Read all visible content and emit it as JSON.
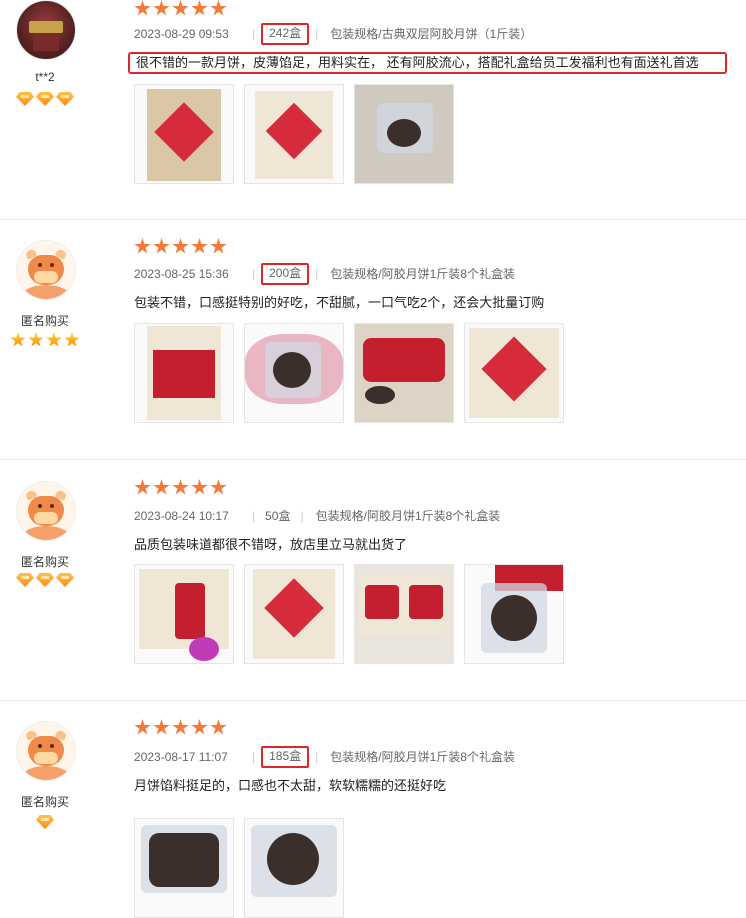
{
  "reviews": [
    {
      "user": "t**2",
      "avatar": "photo-avatar",
      "badge_type": "gem",
      "badge_count": 3,
      "rating": 5,
      "date": "2023-08-29 09:53",
      "quantity": "242盒",
      "spec": "包装规格/古典双层阿胶月饼（1斤装）",
      "text": "很不错的一款月饼，皮薄馅足，用料实在， 还有阿胶流心，搭配礼盒给员工发福利也有面送礼首选",
      "image_count": 3
    },
    {
      "user": "匿名购买",
      "avatar": "cow-avatar",
      "badge_type": "star",
      "badge_count": 4,
      "rating": 5,
      "date": "2023-08-25 15:36",
      "quantity": "200盒",
      "spec": "包装规格/阿胶月饼1斤装8个礼盒装",
      "text": "包装不错，口感挺特别的好吃，不甜腻，一口气吃2个，还会大批量订购",
      "image_count": 4
    },
    {
      "user": "匿名购买",
      "avatar": "cow-avatar",
      "badge_type": "gem",
      "badge_count": 3,
      "rating": 5,
      "date": "2023-08-24 10:17",
      "quantity": "50盒",
      "spec": "包装规格/阿胶月饼1斤装8个礼盒装",
      "text": "品质包装味道都很不错呀，放店里立马就出货了",
      "image_count": 4
    },
    {
      "user": "匿名购买",
      "avatar": "cow-avatar",
      "badge_type": "gem",
      "badge_count": 1,
      "rating": 5,
      "date": "2023-08-17 11:07",
      "quantity": "185盒",
      "spec": "包装规格/阿胶月饼1斤装8个礼盒装",
      "text": "月饼馅料挺足的，口感也不太甜，软软糯糯的还挺好吃",
      "image_count": 2
    }
  ],
  "colors": {
    "star": "#f47a3a",
    "highlight_border": "#e0262a",
    "separator": "#e8e8e8"
  }
}
